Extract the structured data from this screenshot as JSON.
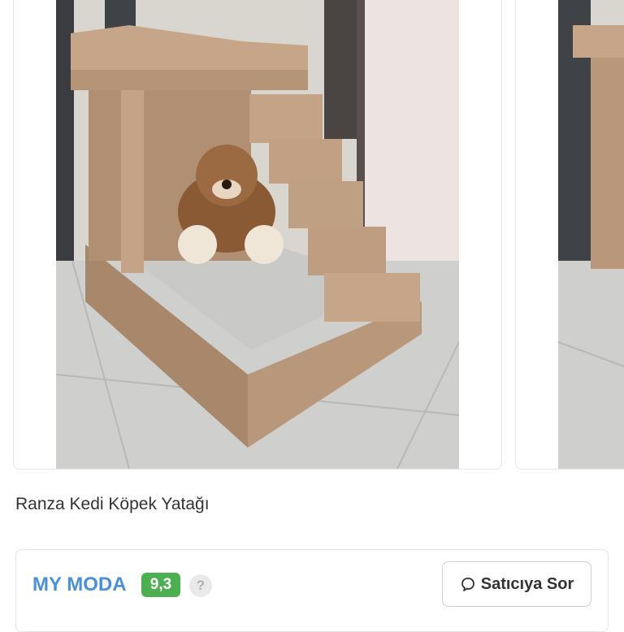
{
  "product": {
    "title": "Ranza Kedi Köpek Yatağı"
  },
  "seller": {
    "name": "MY MODA",
    "rating": "9,3",
    "help_glyph": "?",
    "ask_button_label": "Satıcıya Sor",
    "rating_color": "#4caf50",
    "name_color": "#4a90d9"
  },
  "icons": {
    "ask_button_icon": "chat-bubble-icon",
    "help_icon": "question-mark-icon"
  }
}
